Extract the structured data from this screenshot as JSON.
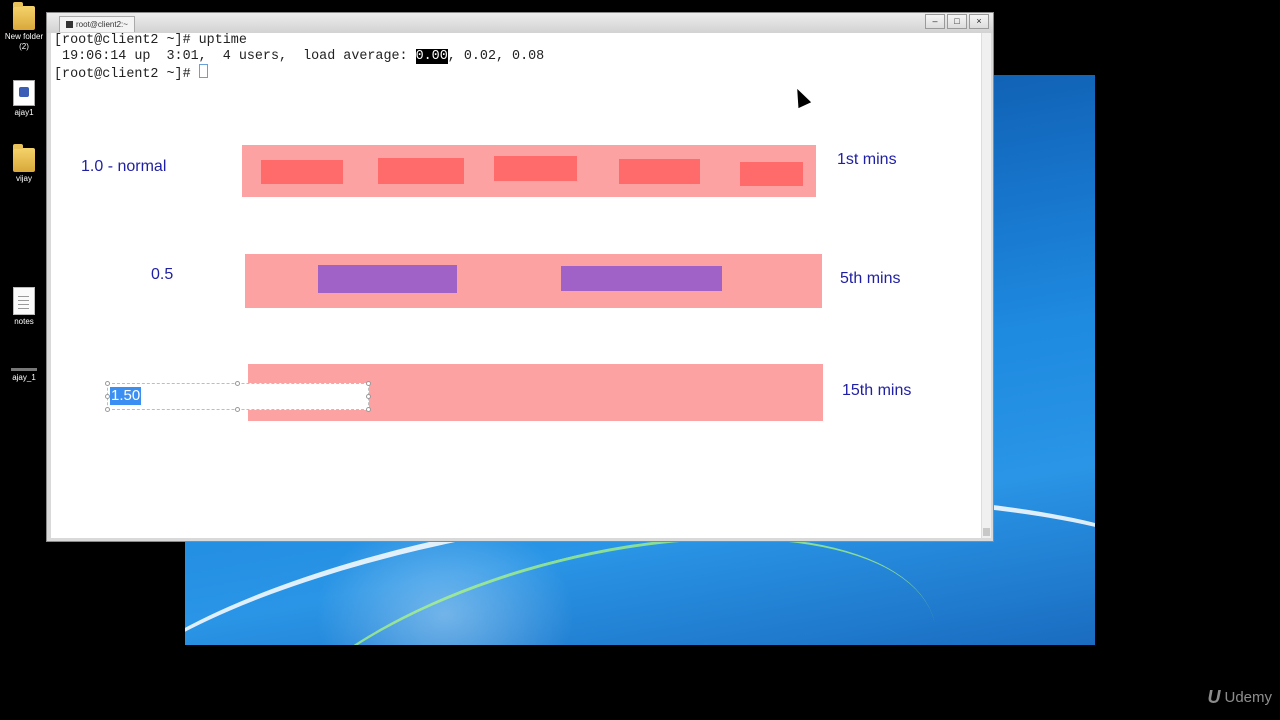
{
  "desktop": {
    "icons": [
      {
        "label": "New folder (2)",
        "type": "folder-icon"
      },
      {
        "label": "ajay1",
        "type": "script-icon"
      },
      {
        "label": "vijay",
        "type": "folder-icon"
      },
      {
        "label": "notes",
        "type": "file-icon"
      },
      {
        "label": "ajay_1",
        "type": "shortcut-icon"
      }
    ]
  },
  "window": {
    "tab_title": "root@client2:~",
    "buttons": {
      "minimize": "–",
      "maximize": "□",
      "close": "×"
    }
  },
  "terminal": {
    "line1": "[root@client2 ~]# uptime",
    "line2_prefix": " 19:06:14 up  3:01,  4 users,  load average: ",
    "load_1min": "0.00",
    "line2_suffix": ", 0.02, 0.08",
    "line3": "[root@client2 ~]# "
  },
  "drawing": {
    "row1": {
      "left_label": "1.0 - normal",
      "right_label": "1st mins",
      "block_color": "#ff6b6b"
    },
    "row2": {
      "left_label": "0.5",
      "right_label": "5th mins",
      "block_color": "#a162c7"
    },
    "row3": {
      "left_label": "1.50",
      "right_label": "15th mins"
    },
    "bar_color": "#fca2a2",
    "label_color": "#1f1fa3"
  },
  "watermark": {
    "logo": "U",
    "text": "Udemy"
  }
}
